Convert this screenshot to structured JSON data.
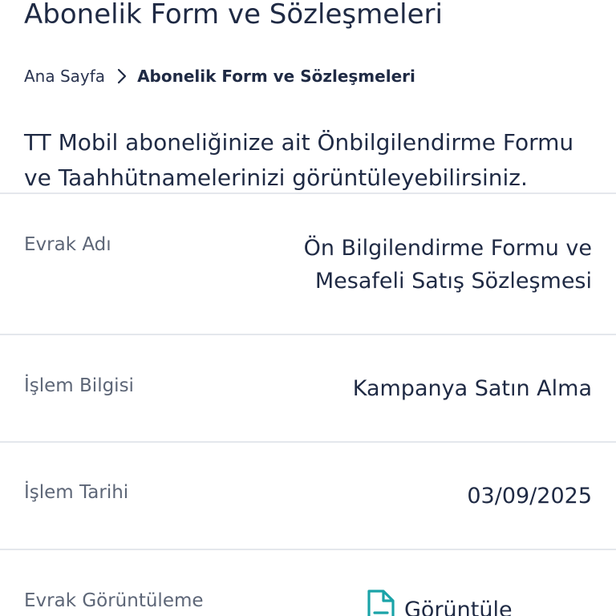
{
  "header": {
    "title": "Abonelik Form ve Sözleşmeleri"
  },
  "breadcrumb": {
    "home": "Ana Sayfa",
    "current": "Abonelik Form ve Sözleşmeleri"
  },
  "intro": {
    "text": "TT Mobil aboneliğinize ait Önbilgilendirme Formu ve Taahhütnamelerinizi görüntüleyebilirsiniz."
  },
  "details": {
    "document": {
      "label": "Evrak Adı",
      "value_line1": "Ön Bilgilendirme Formu ve",
      "value_line2": "Mesafeli Satış Sözleşmesi"
    },
    "transaction": {
      "label": "İşlem Bilgisi",
      "value": "Kampanya Satın Alma"
    },
    "date": {
      "label": "İşlem Tarihi",
      "value": "03/09/2025"
    },
    "view": {
      "label": "Evrak Görüntüleme",
      "link_label": "Görüntüle"
    }
  },
  "colors": {
    "text": "#1f2a44",
    "muted": "#5d6677",
    "accent": "#1aa3a8",
    "divider": "#e4e7ec"
  },
  "icons": {
    "breadcrumb_separator": "chevron-right-icon",
    "view": "document-icon"
  }
}
